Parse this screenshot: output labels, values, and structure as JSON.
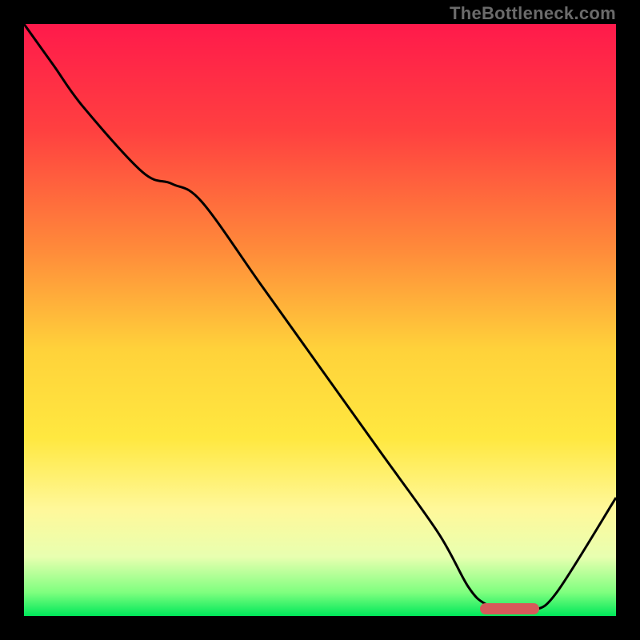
{
  "watermark": "TheBottleneck.com",
  "chart_data": {
    "type": "line",
    "title": "",
    "xlabel": "",
    "ylabel": "",
    "xlim": [
      0,
      100
    ],
    "ylim": [
      0,
      100
    ],
    "gradient_stops": [
      {
        "offset": 0,
        "color": "#ff1a4b"
      },
      {
        "offset": 0.18,
        "color": "#ff4040"
      },
      {
        "offset": 0.38,
        "color": "#ff8a3a"
      },
      {
        "offset": 0.55,
        "color": "#ffd23a"
      },
      {
        "offset": 0.7,
        "color": "#ffe840"
      },
      {
        "offset": 0.82,
        "color": "#fff89a"
      },
      {
        "offset": 0.9,
        "color": "#e8ffb0"
      },
      {
        "offset": 0.96,
        "color": "#7fff7f"
      },
      {
        "offset": 1.0,
        "color": "#00e85a"
      }
    ],
    "series": [
      {
        "name": "bottleneck-curve",
        "x": [
          0,
          5,
          10,
          20,
          25,
          30,
          40,
          50,
          60,
          70,
          75,
          78,
          82,
          86,
          90,
          100
        ],
        "y": [
          100,
          93,
          86,
          75,
          73,
          70,
          56,
          42,
          28,
          14,
          5,
          2,
          1,
          1,
          4,
          20
        ]
      }
    ],
    "marker": {
      "x_start": 77,
      "x_end": 87,
      "y": 1.2
    },
    "grid": false
  }
}
